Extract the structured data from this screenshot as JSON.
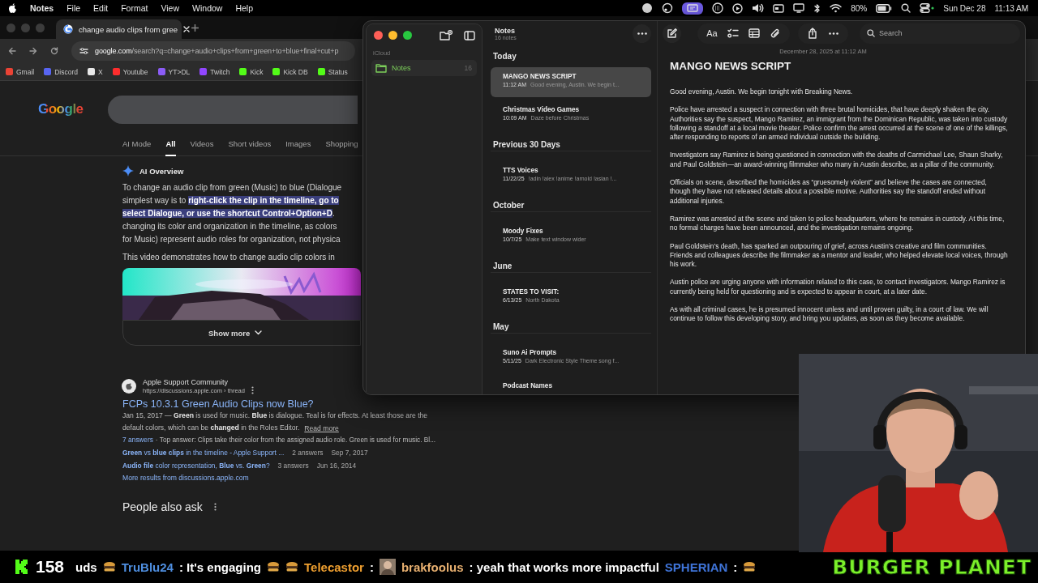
{
  "menu_bar": {
    "app": "Notes",
    "menus": [
      "File",
      "Edit",
      "Format",
      "View",
      "Window",
      "Help"
    ],
    "battery": "80%",
    "date": "Sun Dec 28",
    "time": "11:13 AM"
  },
  "browser": {
    "tab_title": "change audio clips from gree",
    "url_host": "google.com",
    "url_path": "/search?q=change+audio+clips+from+green+to+blue+final+cut+p",
    "bookmarks": [
      {
        "label": "Gmail",
        "color": "#ea4335"
      },
      {
        "label": "Discord",
        "color": "#5865f2"
      },
      {
        "label": "X",
        "color": "#e8e8e8"
      },
      {
        "label": "Youtube",
        "color": "#ff2d2d"
      },
      {
        "label": "YT>DL",
        "color": "#8b5cf6"
      },
      {
        "label": "Twitch",
        "color": "#9146ff"
      },
      {
        "label": "Kick",
        "color": "#53fc18"
      },
      {
        "label": "Kick DB",
        "color": "#53fc18"
      },
      {
        "label": "Status",
        "color": "#53fc18"
      }
    ],
    "logo": "Google",
    "search_tabs": [
      {
        "label": "AI Mode",
        "selected": false
      },
      {
        "label": "All",
        "selected": true
      },
      {
        "label": "Videos",
        "selected": false
      },
      {
        "label": "Short videos",
        "selected": false
      },
      {
        "label": "Images",
        "selected": false
      },
      {
        "label": "Shopping",
        "selected": false
      }
    ],
    "ai_overview": {
      "heading": "AI Overview",
      "lines": [
        "To change an audio clip from green (Music) to blue (Dialogue",
        "simplest way is to **right-click the clip in the timeline, go to**",
        "**select Dialogue, or use the shortcut Control+Option+D**.",
        "changing its color and organization in the timeline, as colors",
        "for Music) represent audio roles for organization, not physica"
      ],
      "video_caption": "This video demonstrates how to change audio clip colors in",
      "show_more": "Show more"
    },
    "result": {
      "site": "Apple Support Community",
      "url": "https://discussions.apple.com › thread",
      "title": "FCPs 10.3.1 Green Audio Clips now Blue?",
      "snippet": [
        "Jan 15, 2017 — **Green** is used for music. **Blue** is dialogue. Teal is for effects. At least those are the",
        "default colors, which can be **changed** in the Roles Editor."
      ],
      "read_more": "Read more",
      "answers_count": "7 answers",
      "answers_text": "· Top answer: Clips take their color from the assigned audio role. Green is used for music. Bl...",
      "sublinks": [
        {
          "title": "**Green** vs **blue clips** in the timeline - Apple Support ...",
          "answers": "2 answers",
          "date": "Sep 7, 2017"
        },
        {
          "title": "**Audio file** color representation, **Blue** vs. **Green**?",
          "answers": "3 answers",
          "date": "Jun 16, 2014"
        }
      ],
      "more": "More results from discussions.apple.com"
    },
    "people_also_ask": "People also ask"
  },
  "notes": {
    "sidebar": {
      "section": "iCloud",
      "folders": [
        {
          "name": "Notes",
          "count": "16",
          "selected": true
        }
      ]
    },
    "list": {
      "title": "Notes",
      "subtitle": "16 notes",
      "groups": [
        {
          "heading": "Today",
          "notes": [
            {
              "title": "MANGO NEWS SCRIPT",
              "date": "11:12 AM",
              "preview": "Good evening, Austin. We begin t...",
              "selected": true
            },
            {
              "title": "Christmas Video Games",
              "date": "10:09 AM",
              "preview": "Daze before Christmas",
              "selected": false
            }
          ]
        },
        {
          "heading": "Previous 30 Days",
          "notes": [
            {
              "title": "TTS Voices",
              "date": "11/22/25",
              "preview": "!adin !alex !anime !arnold !asian !...",
              "selected": false
            }
          ]
        },
        {
          "heading": "October",
          "notes": [
            {
              "title": "Moody Fixes",
              "date": "10/7/25",
              "preview": "Make text window wider",
              "selected": false
            }
          ]
        },
        {
          "heading": "June",
          "notes": [
            {
              "title": "STATES TO VISIT:",
              "date": "6/13/25",
              "preview": "North Dakota",
              "selected": false
            }
          ]
        },
        {
          "heading": "May",
          "notes": [
            {
              "title": "Suno Ai Prompts",
              "date": "5/11/25",
              "preview": "Dark Electronic Style Theme song f...",
              "selected": false
            },
            {
              "title": "Podcast Names",
              "selected": false
            }
          ]
        }
      ]
    },
    "editor": {
      "format_label": "Aa",
      "search_placeholder": "Search",
      "date": "December 28, 2025 at 11:12 AM",
      "title": "MANGO NEWS SCRIPT",
      "paragraphs": [
        "Good evening, Austin. We begin tonight with Breaking News.",
        "Police have arrested a suspect in connection with three brutal homicides, that have deeply shaken the city. Authorities say the suspect, Mango Ramirez, an immigrant from the Dominican Republic, was taken into custody following a standoff at a local movie theater. Police confirm the arrest occurred at the scene of one of the killings, after responding to reports of an armed individual outside the building.",
        "Investigators say Ramirez is being questioned in connection with the deaths of Carmichael Lee, Shaun Sharky, and Paul Goldstein—an award-winning filmmaker who many in Austin describe, as a pillar of the community.",
        "Officials on scene, described the homicides as “gruesomely violent” and believe the cases are connected, though they have not released details about a possible motive. Authorities say the standoff ended without additional injuries.",
        "Ramirez was arrested at the scene and taken to police headquarters, where he remains in custody. At this time, no formal charges have been announced, and the investigation remains ongoing.",
        "Paul Goldstein’s death, has sparked an outpouring of grief, across Austin’s creative and film communities. Friends and colleagues describe the filmmaker as a mentor and leader, who helped elevate local voices, through his work.",
        "Austin police are urging anyone with information related to this case, to contact investigators. Mango Ramirez is currently being held for questioning and is expected to appear in court, at a later date.",
        "As with all criminal cases, he is presumed innocent unless and until proven guilty, in a court of law. We will continue to follow this developing story, and bring you updates, as soon as they become available."
      ]
    }
  },
  "ticker": {
    "viewer_count": "158",
    "items": [
      {
        "kind": "text",
        "text": "uds"
      },
      {
        "kind": "emote"
      },
      {
        "kind": "user",
        "text": "TruBlu24",
        "color": "#4f8fe0"
      },
      {
        "kind": "text",
        "text": ": It's engaging"
      },
      {
        "kind": "emote"
      },
      {
        "kind": "emote"
      },
      {
        "kind": "user",
        "text": "Telecastor",
        "color": "#f0a030"
      },
      {
        "kind": "text",
        "text": ":"
      },
      {
        "kind": "avatar"
      },
      {
        "kind": "user",
        "text": "brakfoolus",
        "color": "#e8b070"
      },
      {
        "kind": "text",
        "text": ": yeah that works more impactful"
      },
      {
        "kind": "user",
        "text": "SPHERIAN",
        "color": "#3f74d8"
      },
      {
        "kind": "text",
        "text": ":"
      },
      {
        "kind": "emote"
      }
    ],
    "banner": "BURGER PLANET"
  }
}
